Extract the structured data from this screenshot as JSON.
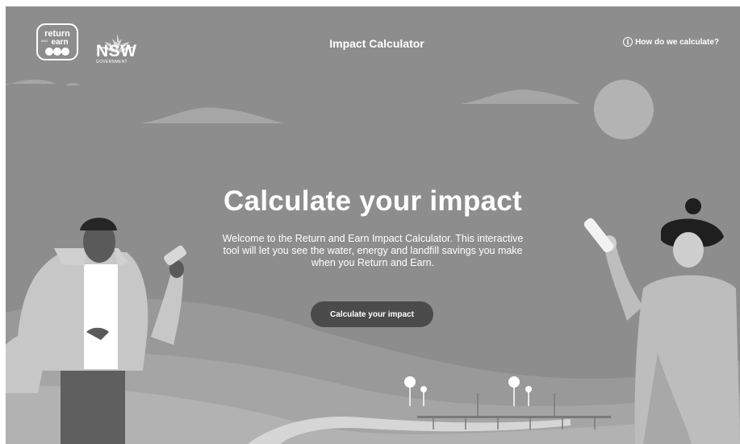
{
  "brand": {
    "return_logo_lines": [
      "return",
      "AND",
      "earn"
    ],
    "nsw_label": "NSW",
    "nsw_sub": "GOVERNMENT"
  },
  "header": {
    "title": "Impact Calculator",
    "help_link": "How do we calculate?"
  },
  "hero": {
    "title": "Calculate your impact",
    "description": "Welcome to the Return and Earn Impact Calculator. This interactive tool will let you see the water, energy and landfill savings you make when you Return and Earn.",
    "button_label": "Calculate your impact"
  },
  "icons": [
    "info-icon",
    "waratah-icon",
    "return-and-earn-logo"
  ],
  "colors": {
    "background": "#8d8d8d",
    "button": "#4b4b4b",
    "text": "#ffffff"
  }
}
